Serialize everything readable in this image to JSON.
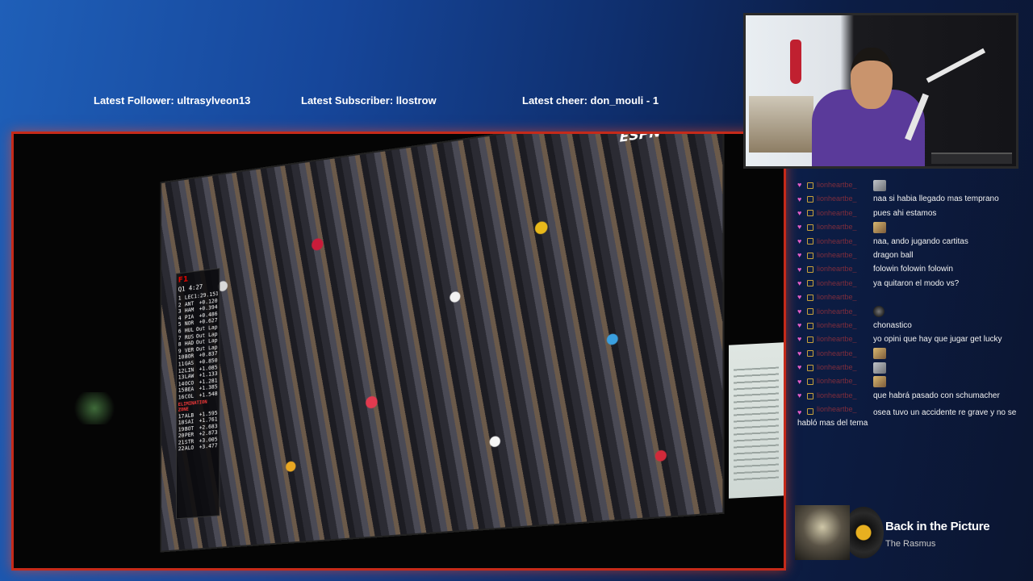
{
  "alerts": {
    "follower_label": "Latest Follower:",
    "follower": "ultrasylveon13",
    "subscriber_label": "Latest Subscriber:",
    "subscriber": "llostrow",
    "cheer_label": "Latest cheer:",
    "cheer": "don_mouli - 1"
  },
  "game": {
    "broadcaster_logo": "ESPN",
    "timing_tower": {
      "logo": "F1",
      "session": "Q1 4:27",
      "rows": [
        {
          "pos": "1",
          "driver": "LEC",
          "time": "1:29.151"
        },
        {
          "pos": "2",
          "driver": "ANT",
          "time": "+0.120"
        },
        {
          "pos": "3",
          "driver": "HAM",
          "time": "+0.394"
        },
        {
          "pos": "4",
          "driver": "PIA",
          "time": "+0.486"
        },
        {
          "pos": "5",
          "driver": "NOR",
          "time": "+0.627"
        },
        {
          "pos": "6",
          "driver": "HUL",
          "time": "Out Lap"
        },
        {
          "pos": "7",
          "driver": "RUS",
          "time": "Out Lap"
        },
        {
          "pos": "8",
          "driver": "HAD",
          "time": "Out Lap"
        },
        {
          "pos": "9",
          "driver": "VER",
          "time": "Out Lap"
        },
        {
          "pos": "10",
          "driver": "BOR",
          "time": "+0.837"
        },
        {
          "pos": "11",
          "driver": "GAS",
          "time": "+0.850"
        },
        {
          "pos": "12",
          "driver": "LIN",
          "time": "+1.085"
        },
        {
          "pos": "13",
          "driver": "LAW",
          "time": "+1.133"
        },
        {
          "pos": "14",
          "driver": "OCO",
          "time": "+1.281"
        },
        {
          "pos": "15",
          "driver": "BEA",
          "time": "+1.385"
        },
        {
          "pos": "16",
          "driver": "COL",
          "time": "+1.548"
        }
      ],
      "elimination_label": "ELIMINATION ZONE",
      "elim_rows": [
        {
          "pos": "17",
          "driver": "ALB",
          "time": "+1.595"
        },
        {
          "pos": "18",
          "driver": "SAI",
          "time": "+1.761"
        },
        {
          "pos": "19",
          "driver": "BOT",
          "time": "+2.683"
        },
        {
          "pos": "20",
          "driver": "PER",
          "time": "+2.873"
        },
        {
          "pos": "21",
          "driver": "STR",
          "time": "+3.005"
        },
        {
          "pos": "22",
          "driver": "ALO",
          "time": "+3.477"
        }
      ]
    }
  },
  "chat": {
    "messages": [
      {
        "user": "lionheartbe_",
        "text": "",
        "emote": "gray"
      },
      {
        "user": "lionheartbe_",
        "text": "naa si habia llegado mas temprano"
      },
      {
        "user": "lionheartbe_",
        "text": "pues ahi estamos"
      },
      {
        "user": "lionheartbe_",
        "text": "",
        "emote": "gold"
      },
      {
        "user": "lionheartbe_",
        "text": "naa, ando jugando cartitas"
      },
      {
        "user": "lionheartbe_",
        "text": "dragon ball"
      },
      {
        "user": "lionheartbe_",
        "text": "folowin folowin folowin"
      },
      {
        "user": "lionheartbe_",
        "text": "ya quitaron el modo vs?"
      },
      {
        "user": "lionheartbe_",
        "text": ""
      },
      {
        "user": "lionheartbe_",
        "text": "",
        "emote": "dark"
      },
      {
        "user": "lionheartbe_",
        "text": "chonastico"
      },
      {
        "user": "lionheartbe_",
        "text": "yo opini que hay que jugar get lucky"
      },
      {
        "user": "lionheartbe_",
        "text": "",
        "emote": "gold"
      },
      {
        "user": "lionheartbe_",
        "text": "",
        "emote": "gray"
      },
      {
        "user": "lionheartbe_",
        "text": "",
        "emote": "gold"
      },
      {
        "user": "lionheartbe_",
        "text": "que habrá pasado con schumacher"
      },
      {
        "user": "lionheartbe_",
        "text": "osea tuvo un accidente re grave y no se habló mas del tema"
      }
    ]
  },
  "now_playing": {
    "title": "Back in the Picture",
    "artist": "The Rasmus"
  },
  "colors": {
    "frame_border": "#c52a1a",
    "background_start": "#1f5fb8",
    "background_end": "#0b1530",
    "heart_badge": "#e35cc6"
  }
}
